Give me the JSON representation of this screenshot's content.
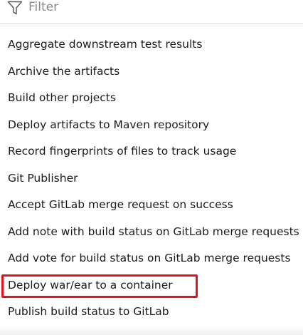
{
  "filter": {
    "placeholder": "Filter",
    "value": "",
    "icon": "funnel-icon"
  },
  "menu": {
    "items": [
      {
        "label": "Aggregate downstream test results"
      },
      {
        "label": "Archive the artifacts"
      },
      {
        "label": "Build other projects"
      },
      {
        "label": "Deploy artifacts to Maven repository"
      },
      {
        "label": "Record fingerprints of files to track usage"
      },
      {
        "label": "Git Publisher"
      },
      {
        "label": "Accept GitLab merge request on success"
      },
      {
        "label": "Add note with build status on GitLab merge requests"
      },
      {
        "label": "Add vote for build status on GitLab merge requests"
      },
      {
        "label": "Deploy war/ear to a container"
      },
      {
        "label": "Publish build status to GitLab"
      }
    ]
  },
  "highlight": {
    "target_item": "Deploy war/ear to a container",
    "color": "#e8121a"
  }
}
